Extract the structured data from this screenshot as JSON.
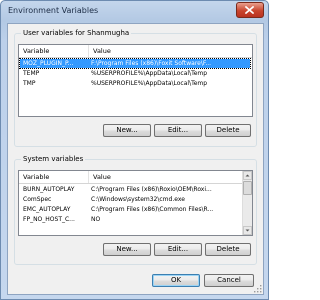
{
  "window": {
    "title": "Environment Variables"
  },
  "user_vars": {
    "legend": "User variables for Shanmugha",
    "columns": [
      "Variable",
      "Value"
    ],
    "rows": [
      {
        "variable": "MOZ_PLUGIN_P...",
        "value": "F:\\Program Files (x86)\\Foxit Software\\F...",
        "selected": true
      },
      {
        "variable": "TEMP",
        "value": "%USERPROFILE%\\AppData\\Local\\Temp"
      },
      {
        "variable": "TMP",
        "value": "%USERPROFILE%\\AppData\\Local\\Temp"
      }
    ],
    "buttons": {
      "new": "New...",
      "edit": "Edit...",
      "delete": "Delete"
    }
  },
  "system_vars": {
    "legend": "System variables",
    "columns": [
      "Variable",
      "Value"
    ],
    "rows": [
      {
        "variable": "BURN_AUTOPLAY",
        "value": "C:\\Program Files (x86)\\Roxio\\OEM\\Roxi..."
      },
      {
        "variable": "ComSpec",
        "value": "C:\\Windows\\system32\\cmd.exe"
      },
      {
        "variable": "EMC_AUTOPLAY",
        "value": "C:\\Program Files (x86)\\Common Files\\R..."
      },
      {
        "variable": "FP_NO_HOST_C...",
        "value": "NO"
      }
    ],
    "buttons": {
      "new": "New...",
      "edit": "Edit...",
      "delete": "Delete"
    }
  },
  "footer": {
    "ok": "OK",
    "cancel": "Cancel"
  },
  "icons": {
    "close": "close-icon",
    "scroll_up": "arrow-up-icon",
    "scroll_down": "arrow-down-icon",
    "grip": "resize-grip-icon"
  },
  "colors": {
    "selection": "#3399ff",
    "close_button": "#c9452e",
    "frame": "#b3c9e4"
  }
}
